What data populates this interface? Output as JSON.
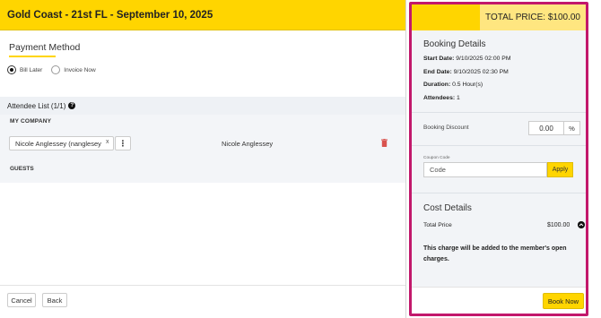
{
  "header": {
    "title": "Gold Coast - 21st FL - September 10, 2025"
  },
  "payment": {
    "title": "Payment Method",
    "options": [
      {
        "label": "Bill Later",
        "selected": true
      },
      {
        "label": "Invoice Now",
        "selected": false
      }
    ]
  },
  "attendees": {
    "title": "Attendee List (1/1)",
    "help_icon": "question-circle-icon",
    "company_label": "MY COMPANY",
    "chip_text": "Nicole Anglessey (nanglesey",
    "chip_remove": "x",
    "row_name": "Nicole Anglessey",
    "guests_label": "GUESTS"
  },
  "footer": {
    "cancel_label": "Cancel",
    "back_label": "Back"
  },
  "summary": {
    "total_label": "TOTAL PRICE: $100.00",
    "booking_title": "Booking Details",
    "start_label": "Start Date:",
    "start_value": " 9/10/2025 02:00 PM",
    "end_label": "End Date:",
    "end_value": " 9/10/2025 02:30 PM",
    "duration_label": "Duration:",
    "duration_value": " 0.5 Hour(s)",
    "attendees_label": "Attendees:",
    "attendees_value": " 1",
    "discount_label": "Booking Discount",
    "discount_value": "0.00",
    "discount_unit": "%",
    "coupon_label": "Coupon Code",
    "coupon_placeholder": "Code",
    "apply_label": "Apply",
    "cost_title": "Cost Details",
    "total_price_label": "Total Price",
    "total_price_value": "$100.00",
    "charge_note": "This charge will be added to the member's open charges.",
    "book_label": "Book Now"
  },
  "colors": {
    "accent": "#ffd500",
    "highlight_border": "#c2186b",
    "danger": "#d9534f"
  }
}
